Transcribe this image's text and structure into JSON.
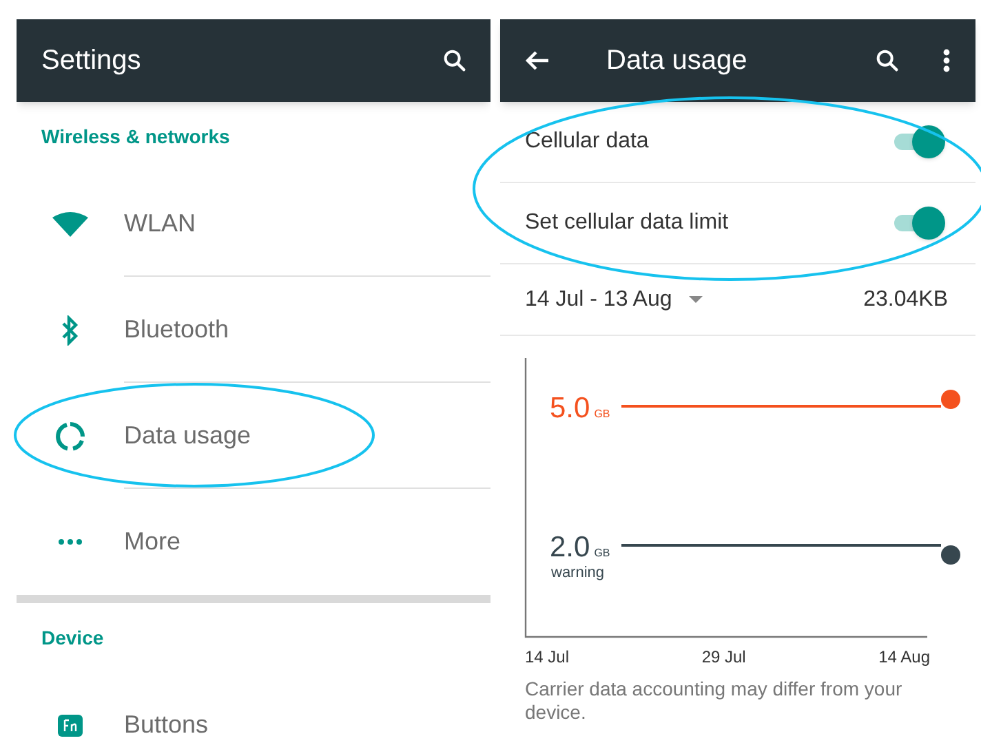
{
  "settings": {
    "title": "Settings",
    "sections": [
      {
        "header": "Wireless & networks",
        "items": [
          {
            "kind": "wifi",
            "label": "WLAN"
          },
          {
            "kind": "bluetooth",
            "label": "Bluetooth"
          },
          {
            "kind": "data",
            "label": "Data usage"
          },
          {
            "kind": "more",
            "label": "More"
          }
        ]
      },
      {
        "header": "Device",
        "items": [
          {
            "kind": "fn",
            "label": "Buttons"
          }
        ]
      }
    ]
  },
  "data_usage": {
    "title": "Data usage",
    "toggles": [
      {
        "label": "Cellular data",
        "on": true
      },
      {
        "label": "Set cellular data limit",
        "on": true
      }
    ],
    "cycle": "14 Jul - 13 Aug",
    "total": "23.04KB",
    "limit": {
      "value": "5.0",
      "unit": "GB"
    },
    "warning": {
      "value": "2.0",
      "unit": "GB",
      "caption": "warning"
    },
    "x_labels": [
      "14 Jul",
      "29 Jul",
      "14 Aug"
    ],
    "note": "Carrier data accounting may differ from your device."
  }
}
